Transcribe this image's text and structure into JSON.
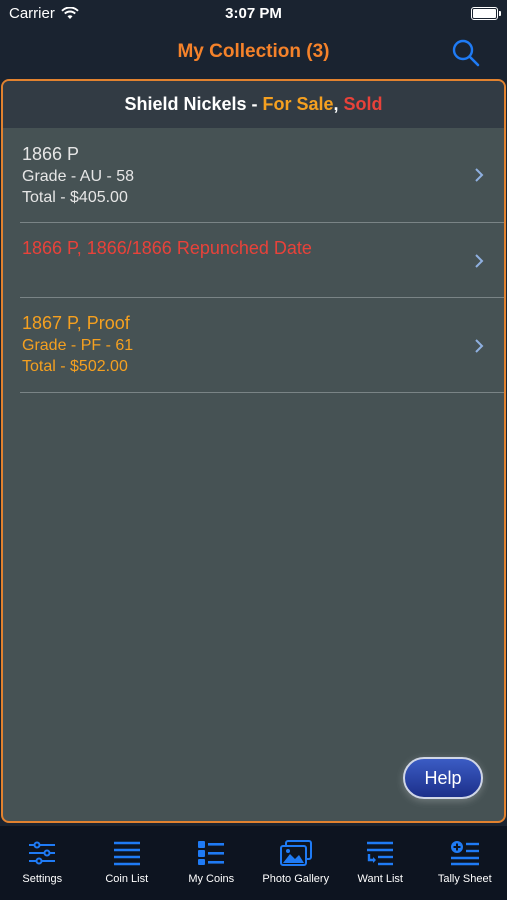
{
  "status": {
    "carrier": "Carrier",
    "time": "3:07 PM"
  },
  "nav": {
    "title": "My Collection (3)"
  },
  "header": {
    "prefix": "Shield Nickels - ",
    "for_sale": "For Sale",
    "separator": ", ",
    "sold": "Sold"
  },
  "coins": [
    {
      "title": "1866 P",
      "grade": "Grade - AU - 58",
      "total": "Total - $405.00",
      "status": "normal"
    },
    {
      "title": "1866 P, 1866/1866 Repunched Date",
      "grade": "",
      "total": "",
      "status": "sold"
    },
    {
      "title": "1867 P, Proof",
      "grade": "Grade - PF - 61",
      "total": "Total - $502.00",
      "status": "for-sale"
    }
  ],
  "help_label": "Help",
  "tabs": [
    {
      "label": "Settings",
      "icon": "sliders-icon"
    },
    {
      "label": "Coin List",
      "icon": "list-icon"
    },
    {
      "label": "My Coins",
      "icon": "grid-list-icon"
    },
    {
      "label": "Photo Gallery",
      "icon": "photos-icon"
    },
    {
      "label": "Want List",
      "icon": "want-list-icon"
    },
    {
      "label": "Tally Sheet",
      "icon": "tally-add-icon"
    }
  ],
  "colors": {
    "accent": "#f5822a",
    "for_sale": "#f5a020",
    "sold": "#e8423a",
    "tab_icon": "#1f7bf5"
  }
}
